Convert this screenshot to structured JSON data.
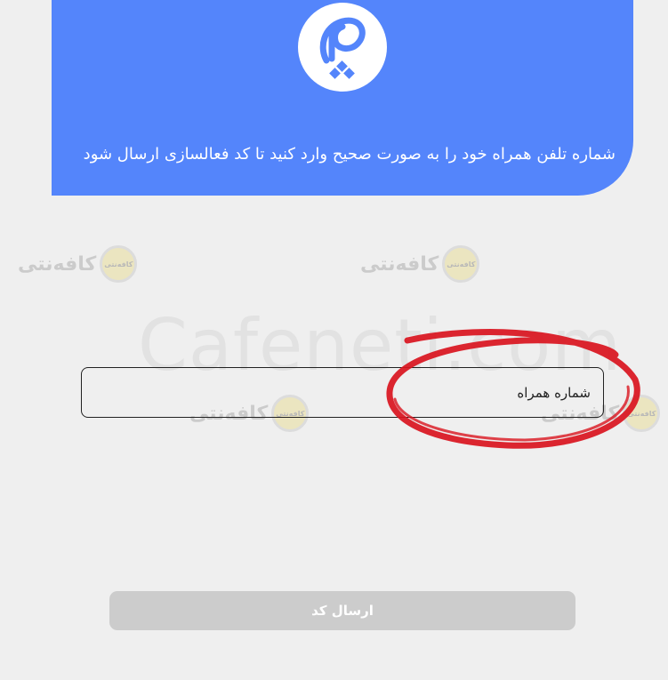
{
  "header": {
    "instruction": "شماره تلفن همراه خود را به صورت صحیح وارد کنید تا کد فعالسازی ارسال شود"
  },
  "watermark": {
    "brand": "کافه‌نتی",
    "seal": "کافه‌نتی",
    "site": "Cafeneti.com"
  },
  "form": {
    "phone_placeholder": "شماره همراه",
    "phone_value": "",
    "submit_label": "ارسال کد"
  },
  "colors": {
    "brand_blue": "#5485fb",
    "background": "#efefef",
    "button_disabled": "#cccccc",
    "annotation_red": "#d9141e"
  },
  "icons": {
    "logo": "pe-letter-logo-icon",
    "annotation": "red-circle-highlight"
  }
}
